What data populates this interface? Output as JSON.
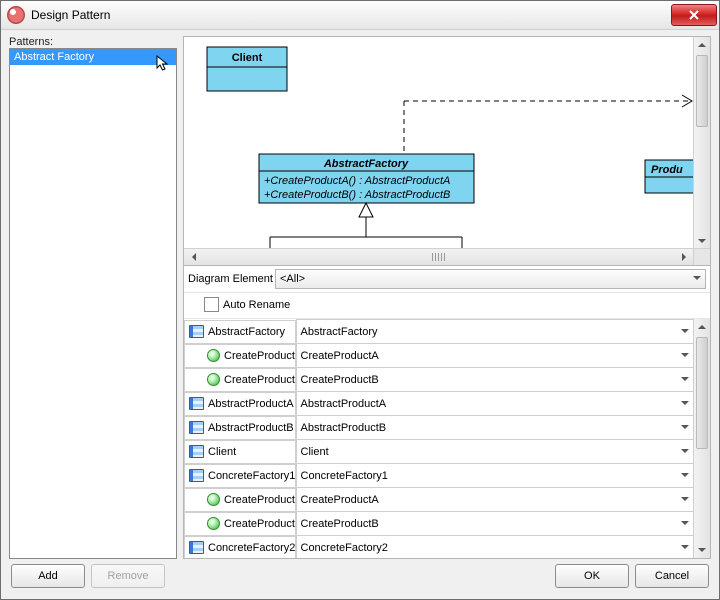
{
  "window": {
    "title": "Design Pattern"
  },
  "left": {
    "label": "Patterns:",
    "items": [
      "Abstract Factory"
    ],
    "selected_index": 0
  },
  "diagram": {
    "client_box": {
      "title": "Client"
    },
    "abstract_factory_box": {
      "title": "AbstractFactory",
      "ops": [
        "+CreateProductA() : AbstractProductA",
        "+CreateProductB() : AbstractProductB"
      ]
    },
    "product_box_partial": {
      "title": "Produ"
    }
  },
  "de_row": {
    "label": "Diagram Element",
    "value": "<All>"
  },
  "auto_rename": {
    "label": "Auto Rename",
    "checked": false
  },
  "elements": [
    {
      "kind": "class",
      "indent": 0,
      "key": "AbstractFactory",
      "value": "AbstractFactory"
    },
    {
      "kind": "op",
      "indent": 1,
      "key": "CreateProductA",
      "value": "CreateProductA"
    },
    {
      "kind": "op",
      "indent": 1,
      "key": "CreateProductB",
      "value": "CreateProductB"
    },
    {
      "kind": "class",
      "indent": 0,
      "key": "AbstractProductA",
      "value": "AbstractProductA"
    },
    {
      "kind": "class",
      "indent": 0,
      "key": "AbstractProductB",
      "value": "AbstractProductB"
    },
    {
      "kind": "class",
      "indent": 0,
      "key": "Client",
      "value": "Client"
    },
    {
      "kind": "class",
      "indent": 0,
      "key": "ConcreteFactory1",
      "value": "ConcreteFactory1"
    },
    {
      "kind": "op",
      "indent": 1,
      "key": "CreateProductA",
      "value": "CreateProductA"
    },
    {
      "kind": "op",
      "indent": 1,
      "key": "CreateProductB",
      "value": "CreateProductB"
    },
    {
      "kind": "class",
      "indent": 0,
      "key": "ConcreteFactory2",
      "value": "ConcreteFactory2"
    }
  ],
  "buttons": {
    "add": "Add",
    "remove": "Remove",
    "ok": "OK",
    "cancel": "Cancel"
  },
  "colors": {
    "uml_fill": "#7fd4f0",
    "uml_stroke": "#000",
    "selection": "#3399ff"
  }
}
